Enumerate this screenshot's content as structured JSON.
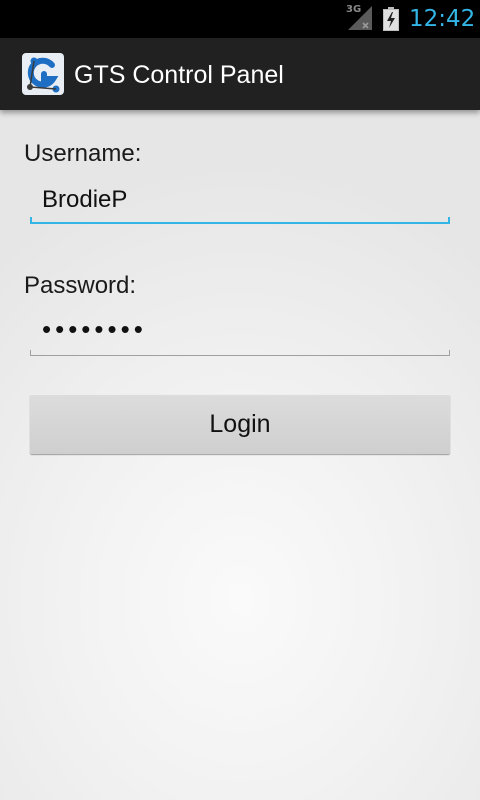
{
  "status_bar": {
    "network_type": "3G",
    "network_icon": "signal-no-data-icon",
    "battery_icon": "battery-charging-icon",
    "time": "12:42",
    "time_color": "#33b5e5"
  },
  "action_bar": {
    "app_icon": "gts-logo-icon",
    "title": "GTS Control Panel"
  },
  "form": {
    "username": {
      "label": "Username:",
      "value": "BrodieP",
      "focused": true
    },
    "password": {
      "label": "Password:",
      "masked_value": "••••••••"
    },
    "login_button": {
      "label": "Login"
    }
  },
  "colors": {
    "accent": "#33b5e5",
    "action_bar": "#212121",
    "status_bar": "#000000"
  }
}
